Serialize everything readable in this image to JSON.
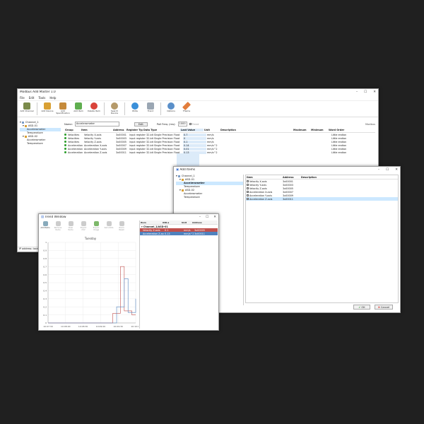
{
  "main": {
    "title": "Modbus Add Master 1.0",
    "menu": [
      "File",
      "Edit",
      "Tools",
      "Help"
    ],
    "toolbar": [
      "Add Channel",
      "Add Device",
      "Add Specification",
      "Add Item",
      "Delete Item",
      "Search Device",
      "Write",
      "Trend",
      "Options",
      "Theme"
    ],
    "name_label": "Name:",
    "name_value": "Accelerometer",
    "edit_button": "Edit",
    "poll_label": "Poll Freq. (ms):",
    "poll_value": "1000",
    "trend_label": "Trend",
    "status_right": "Modbus",
    "tree": [
      "Channel_1",
      "ASD-01",
      "Accelerometer",
      "Temperature",
      "ASD-02",
      "Accelerometer",
      "Temperature"
    ],
    "columns": [
      "Group",
      "Item",
      "Address",
      "Register Type",
      "Data Type",
      "Last Value",
      "Unit",
      "Description",
      "Maximum",
      "Minimum",
      "Word Order"
    ],
    "rows": [
      [
        "Velocities",
        "Velocity X-axis",
        "3x00001",
        "input register",
        "32-bit Single Precision Float",
        "0.7",
        "mm/s",
        "",
        "",
        "",
        "Little endian"
      ],
      [
        "Velocities",
        "Velocity Y-axis",
        "3x00003",
        "input register",
        "32-bit Single Precision Float",
        "0",
        "mm/s",
        "",
        "",
        "",
        "Little endian"
      ],
      [
        "Velocities",
        "Velocity Z-axis",
        "3x00005",
        "input register",
        "32-bit Single Precision Float",
        "0.1",
        "mm/s",
        "",
        "",
        "",
        "Little endian"
      ],
      [
        "Acceleration",
        "Acceleration X-axis",
        "3x00007",
        "input register",
        "32-bit Single Precision Float",
        "0.14",
        "mm/s^2",
        "",
        "",
        "",
        "Little endian"
      ],
      [
        "Acceleration",
        "Acceleration Y-axis",
        "3x00009",
        "input register",
        "32-bit Single Precision Float",
        "0.01",
        "mm/s^2",
        "",
        "",
        "",
        "Little endian"
      ],
      [
        "Acceleration",
        "Acceleration Z-axis",
        "3x00011",
        "input register",
        "32-bit Single Precision Float",
        "0.13",
        "mm/s^2",
        "",
        "",
        "",
        "Little endian"
      ]
    ],
    "statusbar": "IP address: localhost"
  },
  "add_items": {
    "title": "Add Items",
    "tree": [
      "Channel_1",
      "ASD-01",
      "Accelerometer",
      "Temperature",
      "ASD-02",
      "Accelerometer",
      "Temperature"
    ],
    "columns": [
      "Item",
      "Address",
      "Description"
    ],
    "rows": [
      [
        "Velocity X-axis",
        "3x00001",
        ""
      ],
      [
        "Velocity Y-axis",
        "3x00003",
        ""
      ],
      [
        "Velocity Z-axis",
        "3x00005",
        ""
      ],
      [
        "Acceleration X-axis",
        "3x00007",
        ""
      ],
      [
        "Acceleration Y-axis",
        "3x00009",
        ""
      ],
      [
        "Acceleration Z-axis",
        "3x00011",
        ""
      ]
    ],
    "ok": "OK",
    "cancel": "Cancel"
  },
  "trend": {
    "title": "Trend Window",
    "toolbar": [
      "Add Items",
      "Remove Items",
      "Clear Items",
      "Export CSV",
      "Export Image",
      "Set Limits",
      "Zoom Reset"
    ],
    "chart_title": "Tuesday",
    "item_columns": [
      "Item",
      "OID.a",
      "Unit",
      "Address"
    ],
    "channel_row": "Channel_1/ASD-01",
    "items": [
      [
        "Velocity Z-axis",
        "0.1",
        "mm/s",
        "3x00005"
      ],
      [
        "Acceleration Z-axis",
        "0.13",
        "mm/s^2",
        "3x00011"
      ]
    ],
    "series_colors": [
      "#c0504d",
      "#4f81bd"
    ]
  },
  "chart_data": {
    "type": "line",
    "title": "Tuesday",
    "xlabel": "",
    "ylabel": "",
    "x": [
      "10:07:30",
      "10:08:00",
      "10:08:30",
      "10:09:00",
      "10:09:30",
      "10:10:00"
    ],
    "ylim": [
      0,
      1
    ],
    "yticks": [
      "1",
      "0.9",
      "0.8",
      "0.7",
      "0.6",
      "0.5",
      "0.4",
      "0.3",
      "0.2",
      "0.1",
      "0"
    ],
    "series": [
      {
        "values": [
          0,
          0,
          0,
          0,
          0,
          0,
          0,
          0,
          0,
          0,
          0,
          0,
          0,
          0,
          0,
          0,
          0,
          0.12,
          0.12,
          0.7,
          0.15,
          0.15,
          0.1,
          0.1
        ]
      },
      {
        "values": [
          0,
          0,
          0,
          0,
          0,
          0,
          0,
          0,
          0,
          0,
          0,
          0,
          0,
          0,
          0,
          0,
          0,
          0,
          0.2,
          0.2,
          0.55,
          0.13,
          0.13,
          0.3
        ]
      }
    ],
    "grid": true
  }
}
